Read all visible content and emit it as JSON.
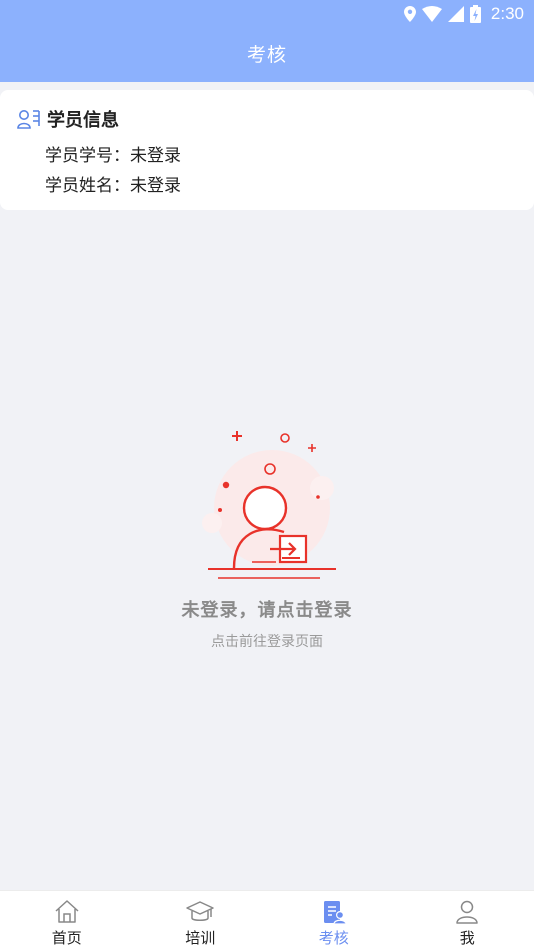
{
  "status_bar": {
    "time": "2:30"
  },
  "header": {
    "title": "考核"
  },
  "student_info": {
    "title": "学员信息",
    "id_label": "学员学号：",
    "id_value": "未登录",
    "name_label": "学员姓名：",
    "name_value": "未登录"
  },
  "empty_state": {
    "title": "未登录，请点击登录",
    "subtitle": "点击前往登录页面"
  },
  "tabs": [
    {
      "label": "首页",
      "icon": "home-icon",
      "active": false
    },
    {
      "label": "培训",
      "icon": "graduation-cap-icon",
      "active": false
    },
    {
      "label": "考核",
      "icon": "exam-icon",
      "active": true
    },
    {
      "label": "我",
      "icon": "user-icon",
      "active": false
    }
  ],
  "colors": {
    "header": "#8cb1fd",
    "accent": "#6b8ef0",
    "illustration": "#e8322a",
    "background": "#f1f2f6"
  }
}
